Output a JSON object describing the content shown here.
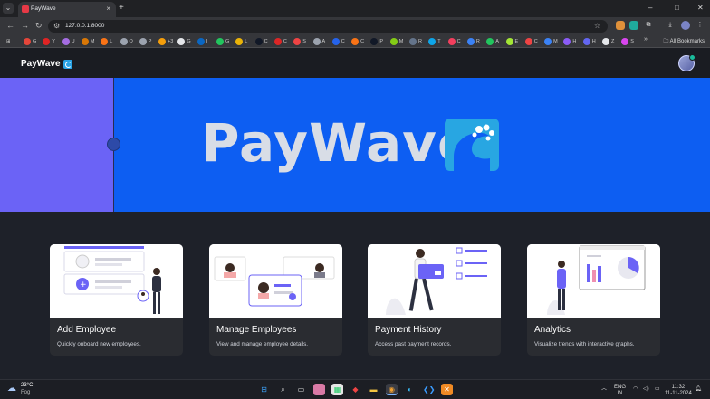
{
  "browser": {
    "tab_title": "PayWave",
    "tab_close": "×",
    "new_tab": "+",
    "window_controls": [
      "–",
      "□",
      "✕"
    ],
    "url": "127.0.0.1:8000",
    "bookmarks": [
      {
        "label": "G",
        "color": "#e4463a"
      },
      {
        "label": "Y",
        "color": "#e02424"
      },
      {
        "label": "U",
        "color": "#a56de2"
      },
      {
        "label": "M",
        "color": "#d97706"
      },
      {
        "label": "L",
        "color": "#f97316"
      },
      {
        "label": "O",
        "color": "#9ca3af"
      },
      {
        "label": "P",
        "color": "#9ca3af"
      },
      {
        "label": "+3",
        "color": "#f59e0b"
      },
      {
        "label": "G",
        "color": "#e5e7eb"
      },
      {
        "label": "I",
        "color": "#0a66c2"
      },
      {
        "label": "G",
        "color": "#22c55e"
      },
      {
        "label": "L",
        "color": "#eab308"
      },
      {
        "label": "C",
        "color": "#111827"
      },
      {
        "label": "C",
        "color": "#dc2626"
      },
      {
        "label": "S",
        "color": "#ef4444"
      },
      {
        "label": "A",
        "color": "#9ca3af"
      },
      {
        "label": "C",
        "color": "#2563eb"
      },
      {
        "label": "C",
        "color": "#f97316"
      },
      {
        "label": "P",
        "color": "#111827"
      },
      {
        "label": "M",
        "color": "#84cc16"
      },
      {
        "label": "R",
        "color": "#64748b"
      },
      {
        "label": "T",
        "color": "#0ea5e9"
      },
      {
        "label": "C",
        "color": "#f43f5e"
      },
      {
        "label": "R",
        "color": "#3b82f6"
      },
      {
        "label": "A",
        "color": "#22c55e"
      },
      {
        "label": "E",
        "color": "#a3e635"
      },
      {
        "label": "C",
        "color": "#ef4444"
      },
      {
        "label": "M",
        "color": "#3b82f6"
      },
      {
        "label": "H",
        "color": "#8b5cf6"
      },
      {
        "label": "H",
        "color": "#6366f1"
      },
      {
        "label": "Z",
        "color": "#e5e7eb"
      },
      {
        "label": "S",
        "color": "#d946ef"
      }
    ],
    "bookmarks_more": "»",
    "all_bookmarks": "All Bookmarks"
  },
  "app": {
    "brand": "PayWave",
    "hero_title": "PayWave"
  },
  "cards": [
    {
      "title": "Add Employee",
      "desc": "Quickly onboard new employees."
    },
    {
      "title": "Manage Employees",
      "desc": "View and manage employee details."
    },
    {
      "title": "Payment History",
      "desc": "Access past payment records."
    },
    {
      "title": "Analytics",
      "desc": "Visualize trends with interactive graphs."
    }
  ],
  "taskbar": {
    "temp": "23°C",
    "weather": "Fog",
    "lang_top": "ENG",
    "lang_bottom": "IN",
    "time": "11:32",
    "date": "11-11-2024"
  },
  "colors": {
    "hero_blue": "#0d5ef2",
    "hero_side": "#6b63f6",
    "card_bg": "#2a2c31",
    "page_bg": "#1e2129"
  }
}
